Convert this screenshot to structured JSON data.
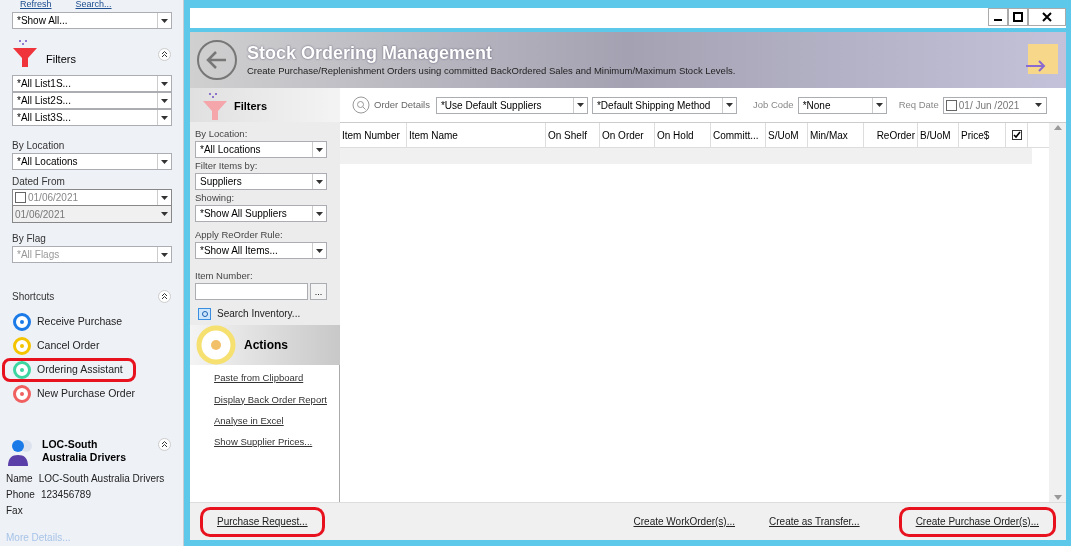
{
  "sidebar": {
    "toolbar": [
      "Refresh",
      "Search..."
    ],
    "view_select": "*Show All...",
    "filters": {
      "title": "Filters",
      "lists": [
        "*All List1S...",
        "*All List2S...",
        "*All List3S..."
      ],
      "location_label": "By Location",
      "location": "*All Locations",
      "dated_label": "Dated From",
      "date_checked": false,
      "date_from": "01/06/2021",
      "date_to": "01/06/2021",
      "flag_label": "By Flag",
      "flag": "*All Flags"
    },
    "shortcuts": {
      "title": "Shortcuts",
      "items": [
        {
          "label": "Receive Purchase",
          "color": "#1a7be8",
          "highlighted": false
        },
        {
          "label": "Cancel Order",
          "color": "#f5c400",
          "highlighted": false
        },
        {
          "label": "Ordering Assistant",
          "color": "#3dd6a0",
          "highlighted": true
        },
        {
          "label": "New Purchase Order",
          "color": "#f06060",
          "highlighted": false
        }
      ]
    },
    "contact": {
      "title": "LOC-South Australia Drivers",
      "fields": [
        {
          "label": "Name",
          "value": "LOC-South Australia Drivers"
        },
        {
          "label": "Phone",
          "value": "123456789"
        },
        {
          "label": "Fax"
        }
      ],
      "link": "More Details..."
    }
  },
  "window": {
    "title": "Stock Ordering Management",
    "subtitle": "Create Purchase/Replenishment Orders using committed BackOrdered Sales and Minimum/Maximum Stock Levels.",
    "order_bar": {
      "label": "Order Details",
      "supplier": "*Use Default Suppliers",
      "shipping": "*Default Shipping Method",
      "job_label": "Job Code",
      "job": "*None",
      "date_label": "Req Date",
      "date_checked": false,
      "date": "01/ Jun /2021"
    },
    "filters": {
      "title": "Filters",
      "fields": [
        {
          "label": "By Location:",
          "value": "*All Locations"
        },
        {
          "label": "Filter Items by:",
          "value": "Suppliers"
        },
        {
          "label": "Showing:",
          "value": "*Show All Suppliers"
        },
        {
          "label": "Apply ReOrder Rule:",
          "value": "*Show All Items..."
        }
      ],
      "item_label": "Item Number:",
      "browse": "...",
      "search_link": "Search Inventory..."
    },
    "actions": {
      "title": "Actions",
      "links": [
        "Paste from Clipboard",
        "Display Back Order Report",
        "Analyse in Excel",
        "Show Supplier Prices..."
      ]
    },
    "table": {
      "columns": [
        "Item Number",
        "Item Name",
        "On Shelf",
        "On Order",
        "On Hold",
        "Committ...",
        "S/UoM",
        "Min/Max",
        "ReOrder",
        "B/UoM",
        "Price$"
      ],
      "select_all_checked": true
    },
    "buttons": [
      {
        "label": "Purchase Request...",
        "highlighted": true
      },
      {
        "label": "Create WorkOrder(s)...",
        "highlighted": false
      },
      {
        "label": "Create as Transfer...",
        "highlighted": false
      },
      {
        "label": "Create Purchase Order(s)...",
        "highlighted": true
      }
    ]
  }
}
